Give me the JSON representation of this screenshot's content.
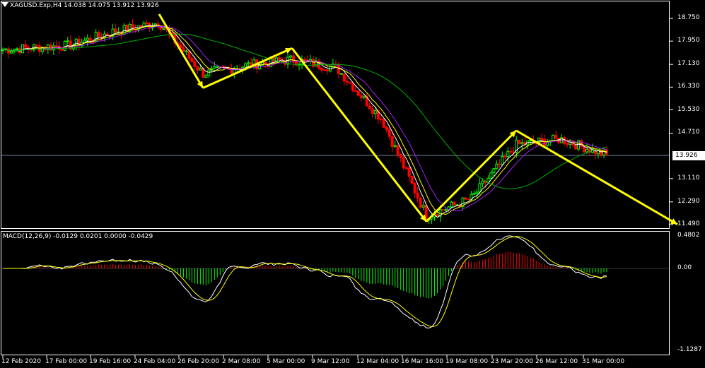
{
  "chart": {
    "symbol_line": "XAGUSD.Exp,H4  14.038 14.075 13.912 13.926",
    "indicator_line": "MACD(12,26,9) -0.0129 0.0201 0.0000 -0.0429",
    "current_price": "13.926",
    "price_ticks": [
      "18.750",
      "17.950",
      "17.130",
      "16.330",
      "15.530",
      "14.710",
      "13.110",
      "12.290",
      "11.490"
    ],
    "macd_ticks": [
      "0.4802",
      "0.00",
      "-1.1287"
    ],
    "time_ticks": [
      "12 Feb 2020",
      "17 Feb 00:00",
      "19 Feb 16:00",
      "24 Feb 04:00",
      "26 Feb 20:00",
      "2 Mar 08:00",
      "5 Mar 00:00",
      "9 Mar 12:00",
      "12 Mar 04:00",
      "16 Mar 16:00",
      "19 Mar 08:00",
      "23 Mar 20:00",
      "26 Mar 12:00",
      "31 Mar 00:00"
    ],
    "colors": {
      "background": "#000000",
      "bull": "#00ff00",
      "bear": "#ff0000",
      "arrow": "#ffff00",
      "ma_fast": "#ffffff",
      "ma_mid": "#ffff00",
      "ma_slow": "#a020f0",
      "ma_long": "#00b000"
    }
  },
  "chart_data": {
    "type": "line",
    "x": [
      "12 Feb 2020",
      "17 Feb 00:00",
      "19 Feb 16:00",
      "24 Feb 04:00",
      "26 Feb 20:00",
      "2 Mar 08:00",
      "5 Mar 00:00",
      "9 Mar 12:00",
      "12 Mar 04:00",
      "16 Mar 16:00",
      "19 Mar 08:00",
      "23 Mar 20:00",
      "26 Mar 12:00",
      "31 Mar 00:00"
    ],
    "series": [
      {
        "values": [
          17.65,
          17.8,
          18.3,
          18.6,
          16.8,
          17.1,
          17.3,
          17.0,
          15.2,
          11.8,
          12.4,
          14.3,
          14.5,
          13.93
        ]
      }
    ],
    "ylim": [
      11.49,
      19.1
    ],
    "trend_arrows": [
      {
        "from": [
          "24 Feb 04:00",
          18.9
        ],
        "to": [
          "26 Feb 20:00",
          16.3
        ]
      },
      {
        "from": [
          "26 Feb 20:00",
          16.3
        ],
        "to": [
          "5 Mar 00:00",
          17.7
        ]
      },
      {
        "from": [
          "5 Mar 00:00",
          17.7
        ],
        "to": [
          "16 Mar 16:00",
          11.6
        ]
      },
      {
        "from": [
          "16 Mar 16:00",
          11.6
        ],
        "to": [
          "23 Mar 20:00",
          14.8
        ]
      },
      {
        "from": [
          "23 Mar 20:00",
          14.8
        ],
        "to": [
          "31 Mar 00:00",
          11.5
        ]
      }
    ]
  }
}
